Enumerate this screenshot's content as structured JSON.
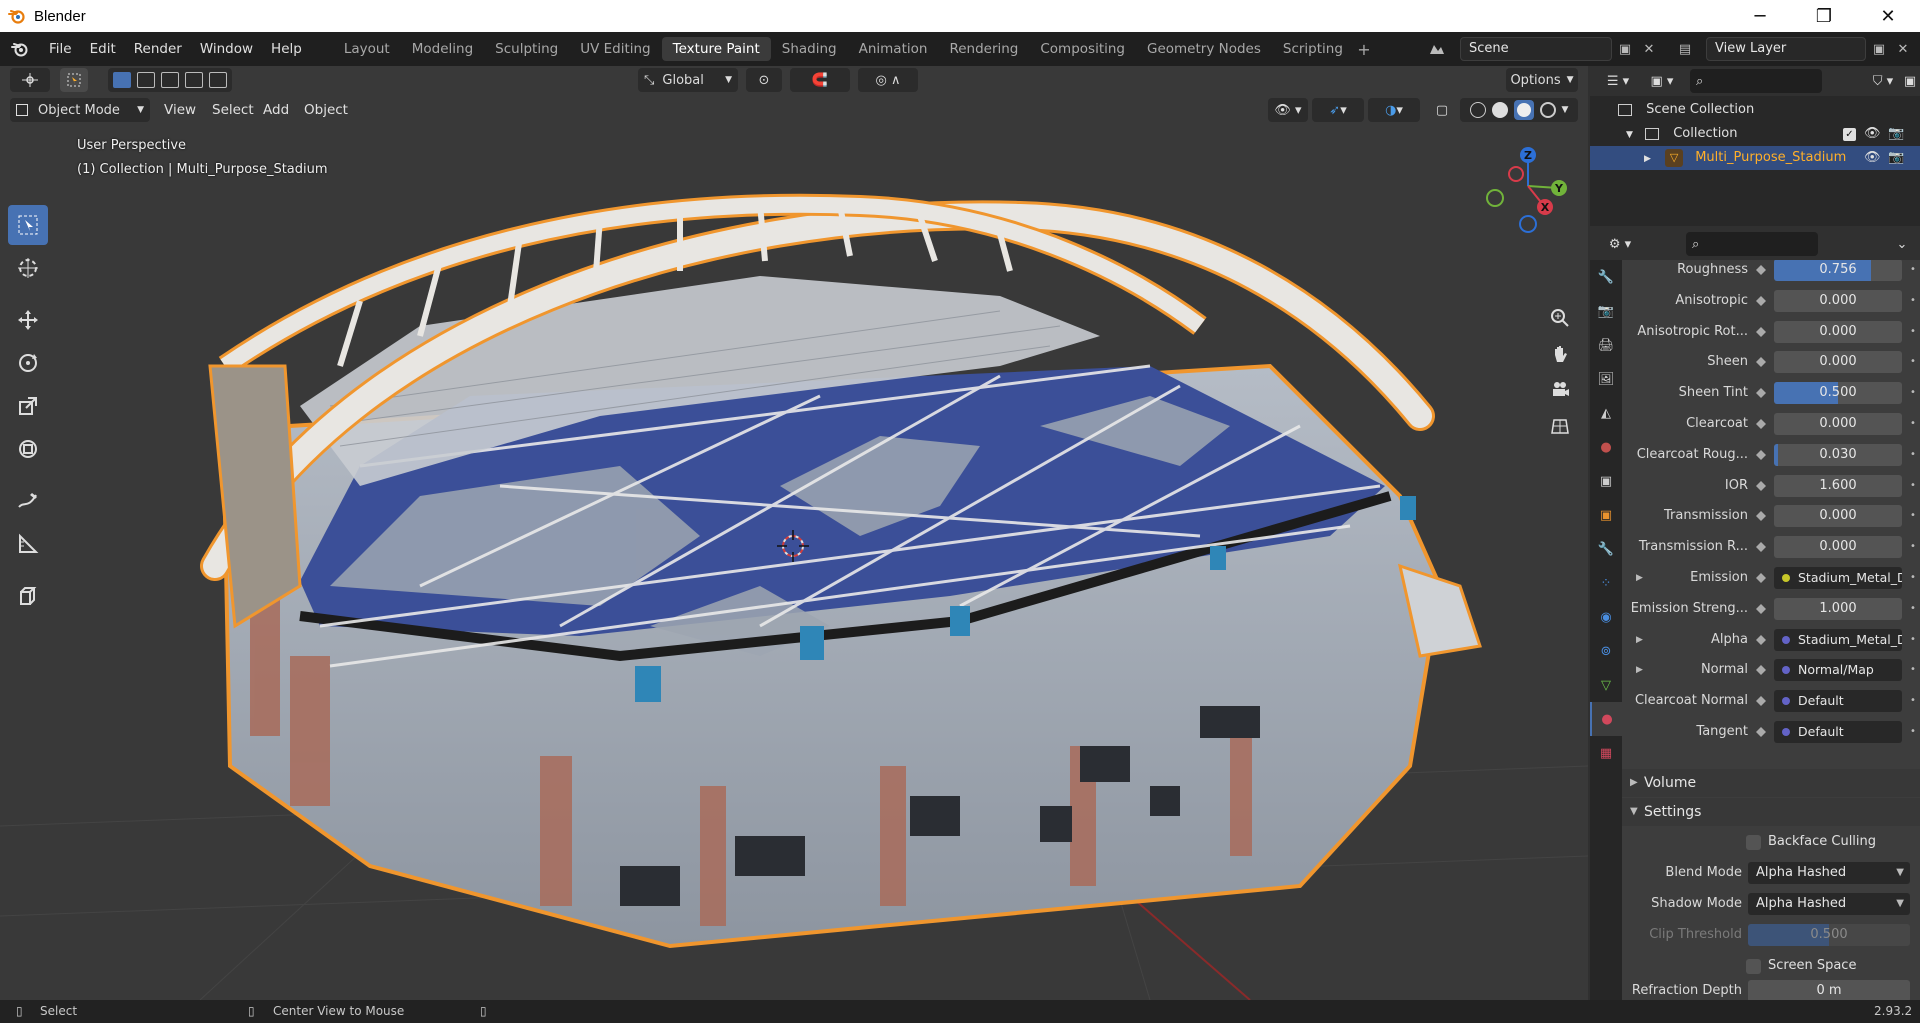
{
  "window": {
    "title": "Blender",
    "controls": [
      "─",
      "❐",
      "✕"
    ]
  },
  "menu": [
    "File",
    "Edit",
    "Render",
    "Window",
    "Help"
  ],
  "workspaces": [
    {
      "label": "Layout",
      "active": false
    },
    {
      "label": "Modeling",
      "active": false
    },
    {
      "label": "Sculpting",
      "active": false
    },
    {
      "label": "UV Editing",
      "active": false
    },
    {
      "label": "Texture Paint",
      "active": true
    },
    {
      "label": "Shading",
      "active": false
    },
    {
      "label": "Animation",
      "active": false
    },
    {
      "label": "Rendering",
      "active": false
    },
    {
      "label": "Compositing",
      "active": false
    },
    {
      "label": "Geometry Nodes",
      "active": false
    },
    {
      "label": "Scripting",
      "active": false
    }
  ],
  "scene": {
    "name": "Scene",
    "view_layer": "View Layer"
  },
  "viewport": {
    "mode": "Object Mode",
    "header_menus": [
      "View",
      "Select",
      "Add",
      "Object"
    ],
    "transform_orientation": "Global",
    "options_label": "Options",
    "perspective_label": "User Perspective",
    "collection_label": "(1) Collection | Multi_Purpose_Stadium",
    "gizmo_axes": {
      "x": "X",
      "y": "Y",
      "z": "Z"
    }
  },
  "outliner": {
    "scene_collection": "Scene Collection",
    "collection": "Collection",
    "object": "Multi_Purpose_Stadium"
  },
  "properties": {
    "rows": [
      {
        "label": "Roughness",
        "type": "slider",
        "value": "0.756",
        "fill": 0.756
      },
      {
        "label": "Anisotropic",
        "type": "slider",
        "value": "0.000",
        "fill": 0
      },
      {
        "label": "Anisotropic Rot...",
        "type": "slider",
        "value": "0.000",
        "fill": 0
      },
      {
        "label": "Sheen",
        "type": "slider",
        "value": "0.000",
        "fill": 0
      },
      {
        "label": "Sheen Tint",
        "type": "slider",
        "value": "0.500",
        "fill": 0.5
      },
      {
        "label": "Clearcoat",
        "type": "slider",
        "value": "0.000",
        "fill": 0
      },
      {
        "label": "Clearcoat Roug...",
        "type": "slider",
        "value": "0.030",
        "fill": 0.03
      },
      {
        "label": "IOR",
        "type": "number",
        "value": "1.600",
        "fill": 0
      },
      {
        "label": "Transmission",
        "type": "slider",
        "value": "0.000",
        "fill": 0
      },
      {
        "label": "Transmission R...",
        "type": "slider",
        "value": "0.000",
        "fill": 0
      },
      {
        "label": "Emission",
        "type": "link",
        "value": "Stadium_Metal_Det...",
        "socket": "#c7c729",
        "expander": true
      },
      {
        "label": "Emission Streng...",
        "type": "number",
        "value": "1.000",
        "fill": 0
      },
      {
        "label": "Alpha",
        "type": "link",
        "value": "Stadium_Metal_Det...",
        "socket": "#6363c7",
        "expander": true
      },
      {
        "label": "Normal",
        "type": "link",
        "value": "Normal/Map",
        "socket": "#6363c7",
        "expander": true
      },
      {
        "label": "Clearcoat Normal",
        "type": "link",
        "value": "Default",
        "socket": "#6363c7",
        "expander": false
      },
      {
        "label": "Tangent",
        "type": "link",
        "value": "Default",
        "socket": "#6363c7",
        "expander": false
      }
    ],
    "volume_label": "Volume",
    "settings_label": "Settings",
    "backface_culling": "Backface Culling",
    "blend_mode_label": "Blend Mode",
    "blend_mode": "Alpha Hashed",
    "shadow_mode_label": "Shadow Mode",
    "shadow_mode": "Alpha Hashed",
    "clip_threshold_label": "Clip Threshold",
    "clip_threshold": "0.500",
    "screen_space_refraction": "Screen Space Refraction",
    "refraction_depth_label": "Refraction Depth",
    "refraction_depth": "0 m"
  },
  "statusbar": {
    "select": "Select",
    "center_view": "Center View to Mouse",
    "version": "2.93.2"
  },
  "colors": {
    "accent": "#4772b3",
    "selection_orange": "#ffaf29",
    "active_tab": "#3b3b3b"
  }
}
